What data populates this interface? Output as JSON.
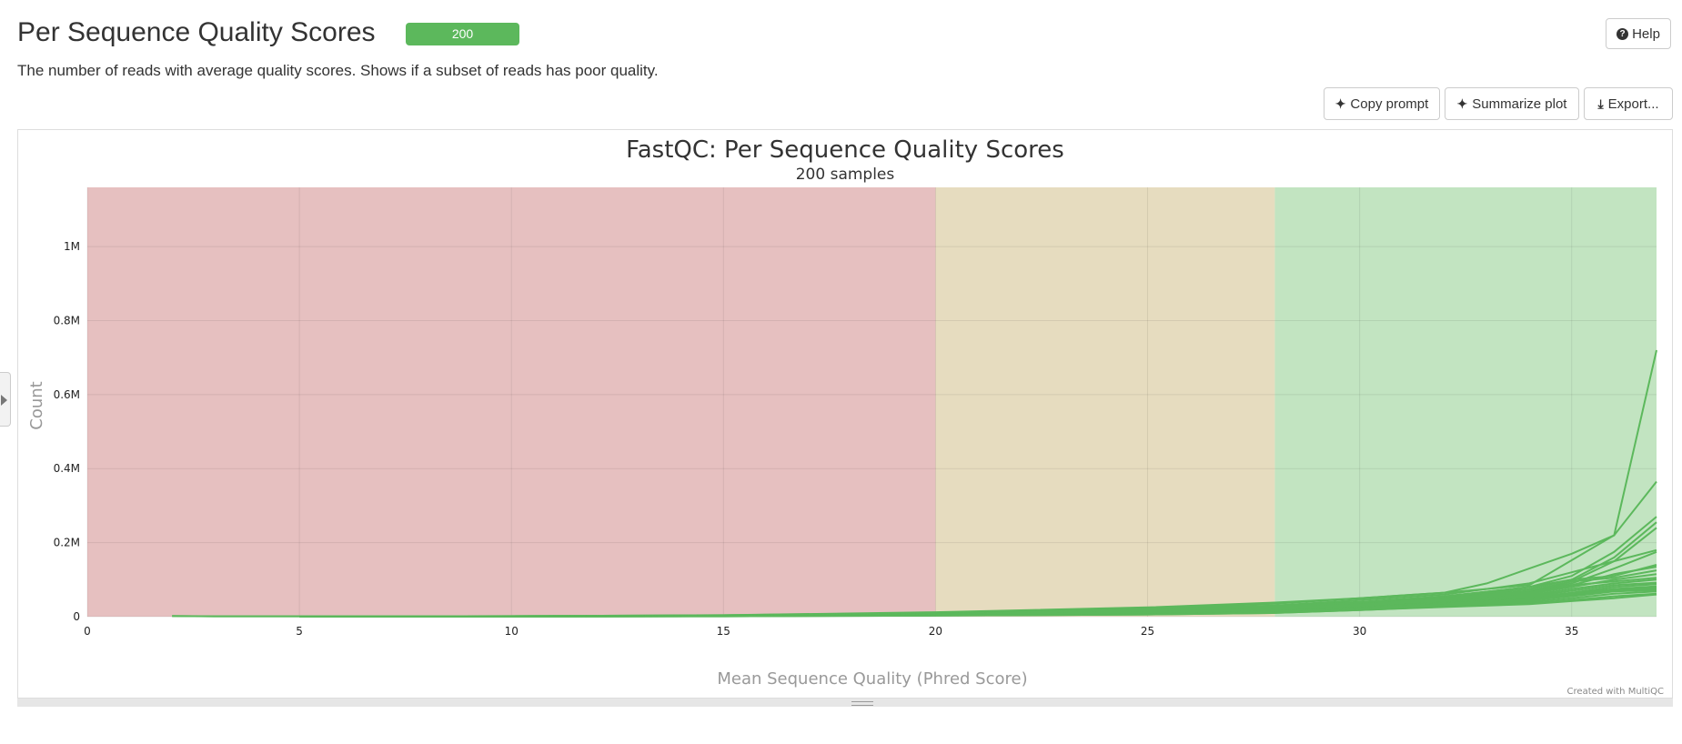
{
  "header": {
    "title": "Per Sequence Quality Scores",
    "badge": "200",
    "help_label": "Help",
    "description": "The number of reads with average quality scores. Shows if a subset of reads has poor quality."
  },
  "toolbar": {
    "copy_prompt": "Copy prompt",
    "summarize_plot": "Summarize plot",
    "export": "Export..."
  },
  "icons": {
    "help": "question-circle-icon",
    "copy_prompt": "sparkle-icon",
    "summarize": "sparkle-icon",
    "export": "download-icon",
    "side_toggle": "chevron-right-icon"
  },
  "colors": {
    "badge": "#5cb85c",
    "line": "#5cb85c",
    "band_fail": "#e6c0c0",
    "band_warn": "#e6dcbf",
    "band_pass": "#c2e4c1"
  },
  "chart_data": {
    "type": "line",
    "title": "FastQC: Per Sequence Quality Scores",
    "subtitle": "200 samples",
    "xlabel": "Mean Sequence Quality (Phred Score)",
    "ylabel": "Count",
    "xlim": [
      0,
      37
    ],
    "ylim": [
      0,
      1160000
    ],
    "x_ticks": [
      0,
      5,
      10,
      15,
      20,
      25,
      30,
      35
    ],
    "y_ticks": [
      {
        "value": 0,
        "label": "0"
      },
      {
        "value": 200000,
        "label": "0.2M"
      },
      {
        "value": 400000,
        "label": "0.4M"
      },
      {
        "value": 600000,
        "label": "0.6M"
      },
      {
        "value": 800000,
        "label": "0.8M"
      },
      {
        "value": 1000000,
        "label": "1M"
      }
    ],
    "bands": [
      {
        "from": 0,
        "to": 20,
        "status": "fail"
      },
      {
        "from": 20,
        "to": 28,
        "status": "warn"
      },
      {
        "from": 28,
        "to": 37,
        "status": "pass"
      }
    ],
    "grid": true,
    "credit": "Created with MultiQC",
    "series": [
      {
        "x": [
          2,
          3,
          5,
          10,
          15,
          20,
          25,
          28,
          30,
          32,
          34,
          36,
          37
        ],
        "y": [
          2000,
          1000,
          1000,
          1500,
          4000,
          10000,
          22000,
          35000,
          50000,
          65000,
          85000,
          220000,
          720000
        ]
      },
      {
        "x": [
          2,
          3,
          5,
          10,
          15,
          20,
          25,
          28,
          30,
          32,
          33,
          34,
          35,
          36,
          37
        ],
        "y": [
          1500,
          1000,
          1000,
          1500,
          4000,
          12000,
          25000,
          38000,
          50000,
          65000,
          90000,
          130000,
          170000,
          220000,
          365000
        ]
      },
      {
        "x": [
          5,
          10,
          15,
          20,
          25,
          28,
          30,
          32,
          34,
          35,
          36,
          37
        ],
        "y": [
          800,
          1200,
          3000,
          9000,
          20000,
          30000,
          40000,
          55000,
          80000,
          110000,
          175000,
          270000
        ]
      },
      {
        "x": [
          5,
          10,
          15,
          20,
          25,
          28,
          30,
          32,
          34,
          35,
          36,
          37
        ],
        "y": [
          800,
          1200,
          3000,
          9000,
          18000,
          28000,
          38000,
          52000,
          75000,
          100000,
          160000,
          255000
        ]
      },
      {
        "x": [
          5,
          10,
          15,
          20,
          25,
          28,
          30,
          32,
          34,
          35,
          36,
          37
        ],
        "y": [
          800,
          1200,
          3000,
          8000,
          17000,
          26000,
          35000,
          50000,
          70000,
          95000,
          150000,
          240000
        ]
      },
      {
        "x": [
          5,
          10,
          15,
          20,
          25,
          28,
          30,
          32,
          34,
          35,
          36,
          37
        ],
        "y": [
          700,
          1000,
          2500,
          7000,
          15000,
          24000,
          33000,
          48000,
          68000,
          90000,
          130000,
          175000
        ]
      },
      {
        "x": [
          5,
          10,
          15,
          20,
          25,
          28,
          30,
          32,
          34,
          35,
          36,
          37
        ],
        "y": [
          700,
          1000,
          2500,
          7000,
          15000,
          24000,
          32000,
          45000,
          65000,
          85000,
          115000,
          135000
        ]
      },
      {
        "x": [
          5,
          10,
          15,
          20,
          25,
          28,
          30,
          32,
          34,
          35,
          36,
          37
        ],
        "y": [
          700,
          1000,
          2500,
          7000,
          14000,
          22000,
          30000,
          42000,
          62000,
          80000,
          100000,
          115000
        ]
      },
      {
        "x": [
          5,
          10,
          15,
          20,
          25,
          28,
          30,
          32,
          34,
          35,
          36,
          37
        ],
        "y": [
          600,
          900,
          2000,
          6000,
          13000,
          20000,
          28000,
          40000,
          58000,
          75000,
          90000,
          100000
        ]
      },
      {
        "x": [
          5,
          10,
          15,
          20,
          25,
          28,
          30,
          32,
          34,
          35,
          36,
          37
        ],
        "y": [
          600,
          900,
          2000,
          6000,
          12000,
          19000,
          27000,
          38000,
          55000,
          70000,
          85000,
          92000
        ]
      },
      {
        "x": [
          5,
          10,
          15,
          20,
          25,
          28,
          30,
          32,
          34,
          35,
          36,
          37
        ],
        "y": [
          500,
          800,
          2000,
          5500,
          11000,
          18000,
          26000,
          37000,
          52000,
          65000,
          80000,
          88000
        ]
      },
      {
        "x": [
          5,
          10,
          15,
          20,
          25,
          28,
          30,
          32,
          34,
          35,
          36,
          37
        ],
        "y": [
          500,
          800,
          1800,
          5000,
          10000,
          17000,
          25000,
          36000,
          50000,
          62000,
          75000,
          82000
        ]
      },
      {
        "x": [
          5,
          10,
          15,
          20,
          25,
          28,
          30,
          32,
          34,
          35,
          36,
          37
        ],
        "y": [
          500,
          700,
          1800,
          5000,
          10000,
          16000,
          24000,
          35000,
          48000,
          60000,
          72000,
          78000
        ]
      },
      {
        "x": [
          5,
          10,
          15,
          20,
          25,
          28,
          30,
          32,
          34,
          35,
          36,
          37
        ],
        "y": [
          400,
          700,
          1500,
          4500,
          9000,
          15000,
          23000,
          34000,
          46000,
          58000,
          70000,
          75000
        ]
      },
      {
        "x": [
          5,
          10,
          15,
          20,
          25,
          28,
          30,
          32,
          34,
          35,
          36,
          37
        ],
        "y": [
          400,
          600,
          1500,
          4000,
          8000,
          14000,
          22000,
          32000,
          44000,
          55000,
          68000,
          72000
        ]
      },
      {
        "x": [
          5,
          10,
          15,
          20,
          25,
          28,
          30,
          32,
          34,
          35,
          36,
          37
        ],
        "y": [
          300,
          500,
          1200,
          3500,
          7000,
          12000,
          20000,
          30000,
          40000,
          50000,
          62000,
          68000
        ]
      },
      {
        "x": [
          5,
          10,
          15,
          20,
          25,
          28,
          30,
          32,
          34,
          35,
          36,
          37
        ],
        "y": [
          300,
          500,
          1000,
          3000,
          6000,
          10000,
          18000,
          27000,
          36000,
          45000,
          55000,
          62000
        ]
      },
      {
        "x": [
          5,
          10,
          15,
          20,
          25,
          28,
          30,
          32,
          34,
          35,
          36,
          37
        ],
        "y": [
          300,
          500,
          1000,
          3000,
          6000,
          10000,
          18000,
          26000,
          34000,
          42000,
          50000,
          60000
        ]
      },
      {
        "x": [
          20,
          25,
          28,
          30,
          32,
          34,
          35,
          36,
          37
        ],
        "y": [
          6000,
          18000,
          30000,
          45000,
          60000,
          90000,
          120000,
          150000,
          180000
        ]
      },
      {
        "x": [
          20,
          25,
          28,
          30,
          32,
          34,
          35,
          36,
          37
        ],
        "y": [
          5000,
          15000,
          26000,
          38000,
          55000,
          80000,
          100000,
          110000,
          140000
        ]
      },
      {
        "x": [
          20,
          25,
          28,
          30,
          32,
          34,
          35,
          36,
          37
        ],
        "y": [
          4000,
          12000,
          22000,
          33000,
          48000,
          70000,
          95000,
          105000,
          125000
        ]
      },
      {
        "x": [
          20,
          25,
          28,
          30,
          32,
          34,
          35,
          36,
          37
        ],
        "y": [
          4000,
          12000,
          20000,
          30000,
          45000,
          65000,
          85000,
          95000,
          105000
        ]
      }
    ]
  }
}
